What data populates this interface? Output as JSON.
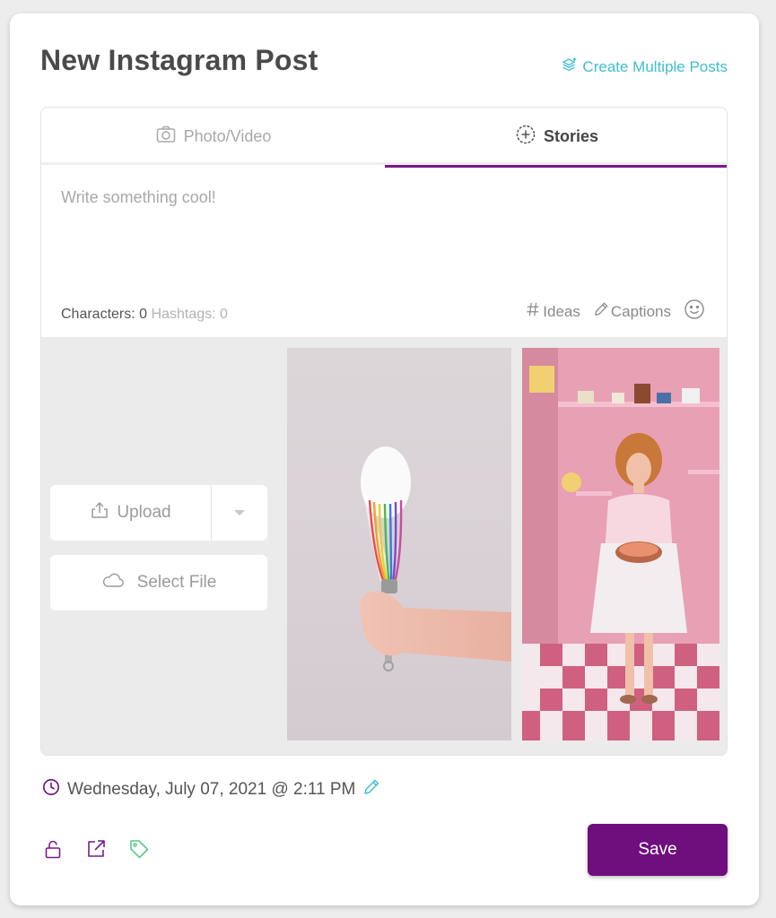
{
  "header": {
    "title": "New Instagram Post",
    "multi_link_label": "Create Multiple Posts"
  },
  "tabs": [
    {
      "label": "Photo/Video",
      "active": false
    },
    {
      "label": "Stories",
      "active": true
    }
  ],
  "caption": {
    "placeholder": "Write something cool!",
    "value": ""
  },
  "stats": {
    "characters_label": "Characters:",
    "characters_value": "0",
    "hashtags_label": "Hashtags:",
    "hashtags_value": "0"
  },
  "tools": {
    "ideas_label": "Ideas",
    "captions_label": "Captions"
  },
  "media": {
    "upload_label": "Upload",
    "select_file_label": "Select File"
  },
  "schedule": {
    "datetime": "Wednesday, July 07, 2021 @ 2:11 PM"
  },
  "footer": {
    "save_label": "Save"
  },
  "colors": {
    "accent": "#6e0f7d",
    "link": "#3fbfcf",
    "tab_underline": "#7a1a8c",
    "tag_icon": "#5cc98a"
  },
  "icons": {
    "multi_link": "stack-plus-icon",
    "photo_tab": "camera-icon",
    "stories_tab": "circle-plus-icon",
    "ideas": "hashtag-icon",
    "captions": "pencil-icon",
    "emoji": "smiley-icon",
    "upload": "upload-icon",
    "select_file": "cloud-icon",
    "schedule": "clock-icon",
    "schedule_edit": "pencil-icon",
    "lock": "lock-icon",
    "external": "external-link-icon",
    "tag": "tag-icon"
  }
}
